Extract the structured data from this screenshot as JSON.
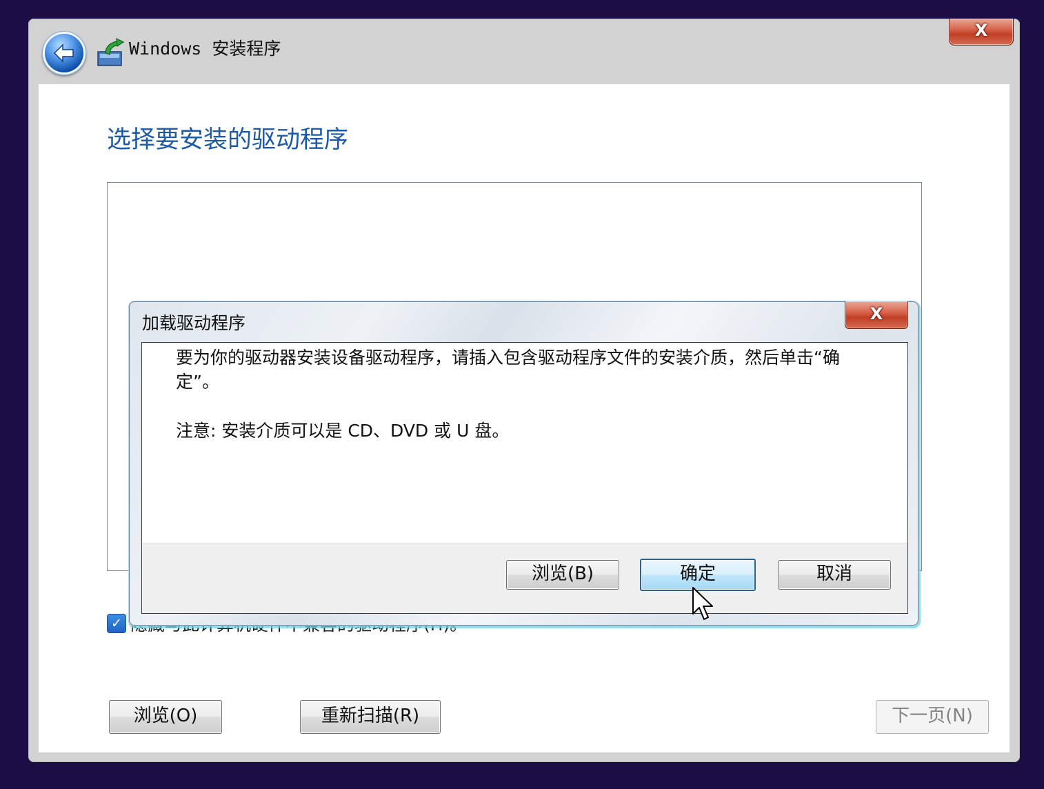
{
  "window": {
    "title": "Windows 安装程序",
    "close_label": "X"
  },
  "page": {
    "title": "选择要安装的驱动程序",
    "hide_incompatible_label": "隐藏与此计算机硬件不兼容的驱动程序(H)。",
    "hide_incompatible_checked": true
  },
  "buttons": {
    "browse": "浏览(O)",
    "rescan": "重新扫描(R)",
    "next": "下一页(N)"
  },
  "dialog": {
    "title": "加载驱动程序",
    "close_label": "X",
    "message": "要为你的驱动器安装设备驱动程序，请插入包含驱动程序文件的安装介质，然后单击“确定”。",
    "note": "注意: 安装介质可以是 CD、DVD 或 U 盘。",
    "browse": "浏览(B)",
    "ok": "确定",
    "cancel": "取消"
  },
  "colors": {
    "desktop": "#1c0e45",
    "title_accent": "#1e5aa6",
    "close_red": "#c03f25",
    "default_button_border": "#2c628b"
  }
}
